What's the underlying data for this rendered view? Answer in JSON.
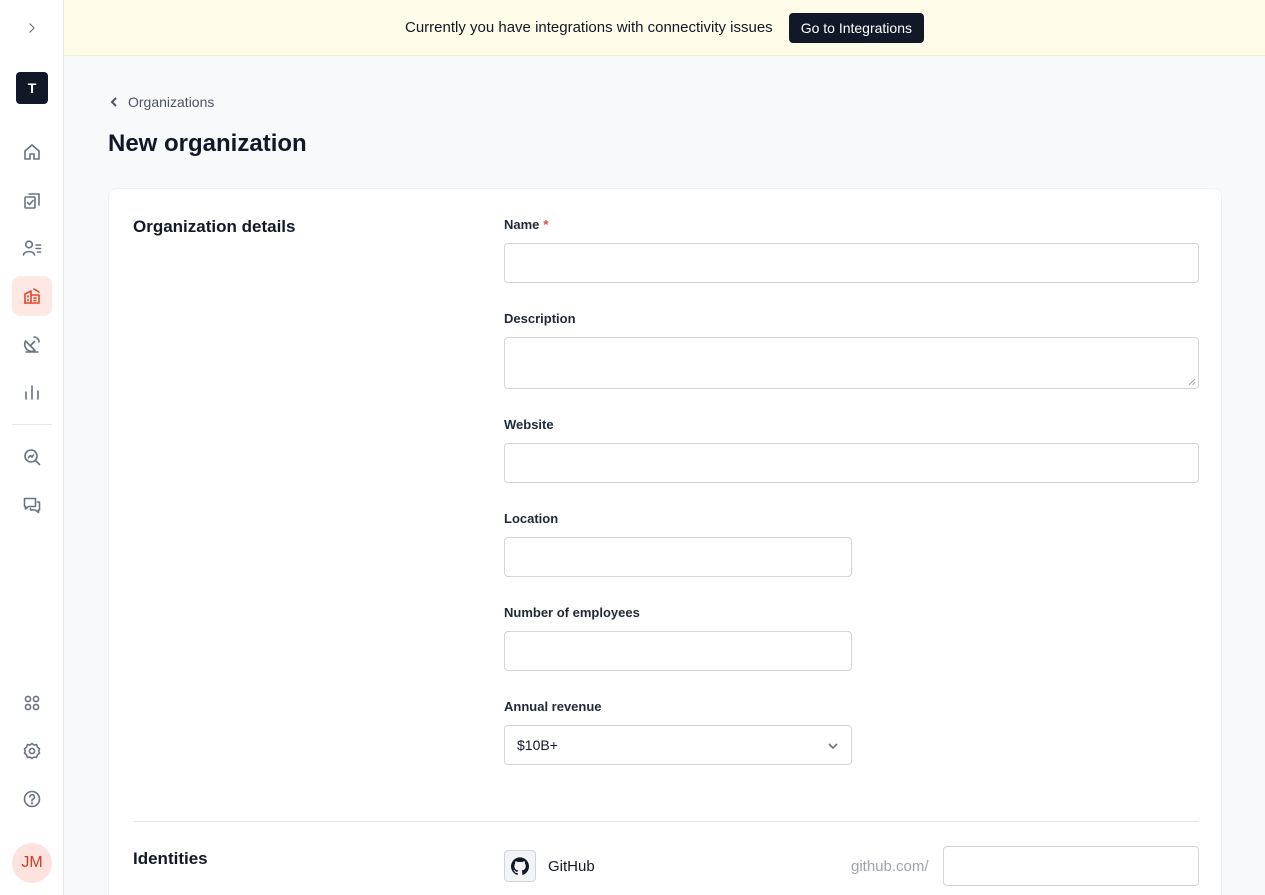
{
  "workspace": {
    "initial": "T"
  },
  "user": {
    "initials": "JM"
  },
  "banner": {
    "message": "Currently you have integrations with connectivity issues",
    "button_label": "Go to Integrations"
  },
  "breadcrumb": {
    "label": "Organizations"
  },
  "page": {
    "title": "New organization"
  },
  "details": {
    "section_title": "Organization details",
    "name_label": "Name",
    "name_required_marker": "*",
    "description_label": "Description",
    "website_label": "Website",
    "location_label": "Location",
    "employees_label": "Number of employees",
    "revenue_label": "Annual revenue",
    "revenue_value": "$10B+"
  },
  "identities": {
    "section_title": "Identities",
    "items": [
      {
        "icon": "github-icon",
        "name": "GitHub",
        "prefix": "github.com/"
      }
    ]
  },
  "colors": {
    "accent": "#e0492f",
    "banner_bg": "#fefce8",
    "dark": "#111827"
  }
}
